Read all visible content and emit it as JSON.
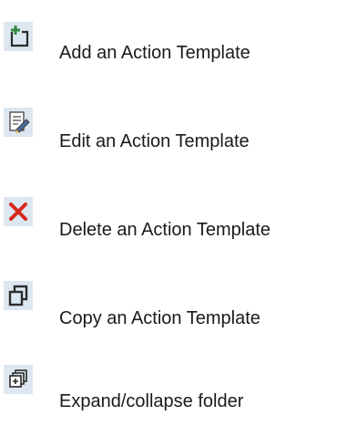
{
  "legend": {
    "items": [
      {
        "icon": "add-template-icon",
        "label": "Add an Action Template"
      },
      {
        "icon": "edit-template-icon",
        "label": "Edit an Action Template"
      },
      {
        "icon": "delete-template-icon",
        "label": "Delete an Action Template"
      },
      {
        "icon": "copy-template-icon",
        "label": "Copy an Action Template"
      },
      {
        "icon": "expand-collapse-folder-icon",
        "label": "Expand/collapse folder"
      }
    ]
  },
  "colors": {
    "icon_background": "#dde7f1",
    "add_accent": "#2e8b3a",
    "delete_red": "#d9291c",
    "icon_dark": "#2b2b2b",
    "text": "#1a1a1a"
  }
}
